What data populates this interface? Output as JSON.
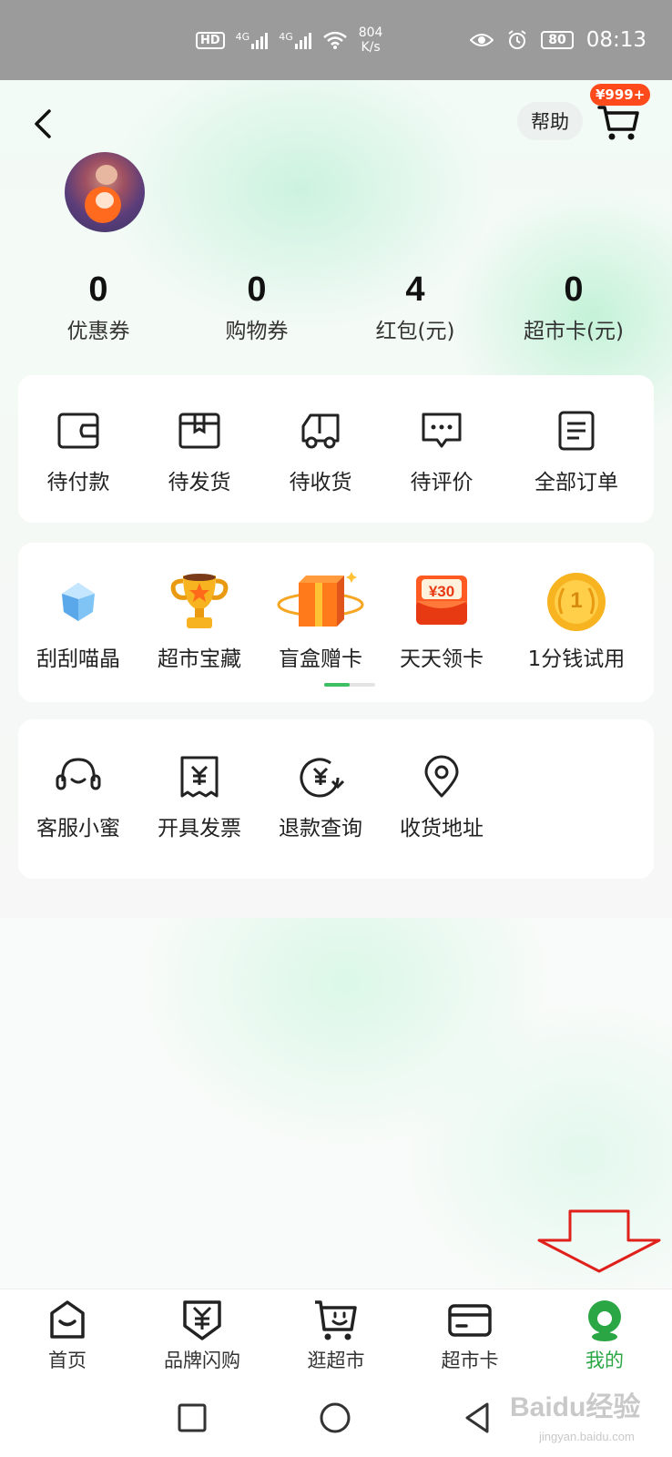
{
  "status_bar": {
    "hd": "HD",
    "net1": "4G",
    "net2": "4G",
    "speed_value": "804",
    "speed_unit": "K/s",
    "battery": "80",
    "time": "08:13"
  },
  "header": {
    "help_label": "帮助",
    "cart_badge": "¥999+"
  },
  "stats": [
    {
      "value": "0",
      "label": "优惠券"
    },
    {
      "value": "0",
      "label": "购物券"
    },
    {
      "value": "4",
      "label": "红包(元)"
    },
    {
      "value": "0",
      "label": "超市卡(元)"
    }
  ],
  "orders": [
    {
      "label": "待付款",
      "icon": "wallet-icon"
    },
    {
      "label": "待发货",
      "icon": "package-icon"
    },
    {
      "label": "待收货",
      "icon": "truck-icon"
    },
    {
      "label": "待评价",
      "icon": "comment-icon"
    },
    {
      "label": "全部订单",
      "icon": "order-list-icon"
    }
  ],
  "features": [
    {
      "label": "刮刮喵晶",
      "icon": "crystal-icon"
    },
    {
      "label": "超市宝藏",
      "icon": "trophy-icon"
    },
    {
      "label": "盲盒赠卡",
      "icon": "gift-box-icon"
    },
    {
      "label": "天天领卡",
      "icon": "card-30-icon",
      "badge": "¥30"
    },
    {
      "label": "1分钱试用",
      "icon": "coin-icon",
      "badge": "1"
    }
  ],
  "services": [
    {
      "label": "客服小蜜",
      "icon": "headset-icon"
    },
    {
      "label": "开具发票",
      "icon": "invoice-icon"
    },
    {
      "label": "退款查询",
      "icon": "refund-icon"
    },
    {
      "label": "收货地址",
      "icon": "location-icon"
    }
  ],
  "tabbar": [
    {
      "label": "首页",
      "icon": "home-icon",
      "active": false
    },
    {
      "label": "品牌闪购",
      "icon": "flash-sale-icon",
      "active": false
    },
    {
      "label": "逛超市",
      "icon": "cart-face-icon",
      "active": false
    },
    {
      "label": "超市卡",
      "icon": "card-icon",
      "active": false
    },
    {
      "label": "我的",
      "icon": "profile-icon",
      "active": true
    }
  ],
  "colors": {
    "accent_green": "#2aa645",
    "badge_red": "#ff4a1c",
    "arrow_red": "#e0201b"
  },
  "watermark": {
    "brand": "Baidu经验",
    "url": "jingyan.baidu.com"
  }
}
